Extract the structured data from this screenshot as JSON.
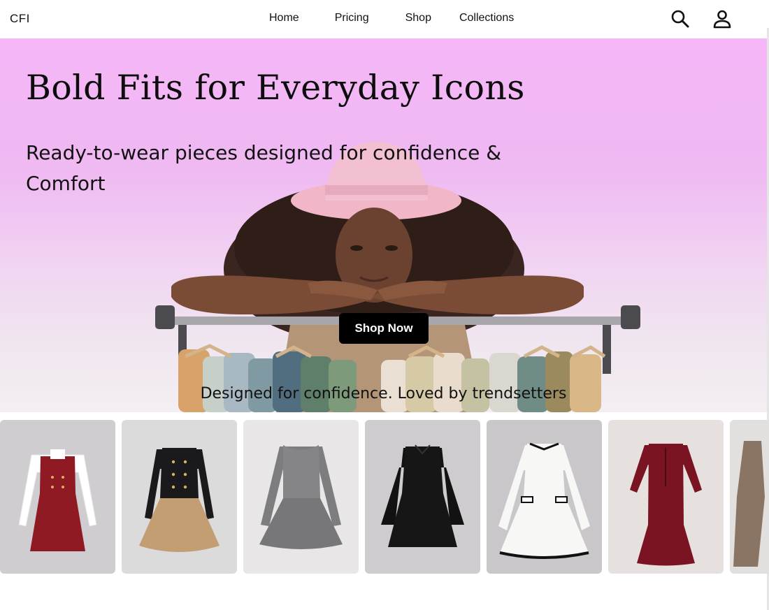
{
  "brand": {
    "logo": "CFI"
  },
  "nav": {
    "links": [
      "Home",
      "Pricing",
      "Shop",
      "Collections"
    ],
    "icons": [
      "search-icon",
      "user-icon"
    ]
  },
  "hero": {
    "title": "Bold Fits for Everyday Icons",
    "subtitle": "Ready-to-wear pieces designed for confidence & Comfort",
    "cta_label": "Shop Now",
    "tagline": "Designed for confidence. Loved by trendsetters"
  },
  "products": [
    {
      "name": "red-pinafore-dress",
      "bg": "#cfcdcf",
      "dress": "#8f1a24",
      "sleeve": "#ffffff"
    },
    {
      "name": "black-tan-corset-dress",
      "bg": "#dcdbdc",
      "dress": "#1a1a1c",
      "skirt": "#c49e73"
    },
    {
      "name": "grey-tweed-dress",
      "bg": "#e8e6e7",
      "dress": "#7d7d7f"
    },
    {
      "name": "black-flare-sleeve-dress",
      "bg": "#cfcccf",
      "dress": "#121212"
    },
    {
      "name": "white-knit-dress",
      "bg": "#c9c7c9",
      "dress": "#f7f7f5",
      "trim": "#111111"
    },
    {
      "name": "burgundy-mermaid-dress",
      "bg": "#e6e1df",
      "dress": "#7a1422"
    },
    {
      "name": "brown-halter-dress",
      "bg": "#e2e0de",
      "dress": "#8a7565"
    }
  ],
  "colors": {
    "accent": "#000000",
    "hero_top": "#f6b6f8",
    "hero_bottom": "#f4eef2"
  }
}
